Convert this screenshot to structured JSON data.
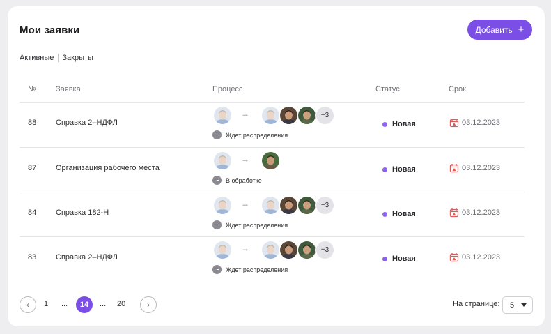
{
  "page": {
    "title": "Мои заявки",
    "add_button": "Добавить",
    "add_icon": "plus-icon"
  },
  "tabs": [
    "Активные",
    "Закрыты"
  ],
  "columns": [
    "№",
    "Заявка",
    "Процесс",
    "Статус",
    "Срок"
  ],
  "rows": [
    {
      "num": "88",
      "request": "Справка 2–НДФЛ",
      "assignees": [
        "a",
        "b",
        "c"
      ],
      "more": "+3",
      "process_status": "Ждет распределения",
      "status": "Новая",
      "deadline": "03.12.2023"
    },
    {
      "num": "87",
      "request": "Организация рабочего места",
      "assignees": [
        "d"
      ],
      "more": "",
      "process_status": "В обработке",
      "status": "Новая",
      "deadline": "03.12.2023"
    },
    {
      "num": "84",
      "request": "Справка 182-Н",
      "assignees": [
        "a",
        "b",
        "c"
      ],
      "more": "+3",
      "process_status": "Ждет распределения",
      "status": "Новая",
      "deadline": "03.12.2023"
    },
    {
      "num": "83",
      "request": "Справка 2–НДФЛ",
      "assignees": [
        "a",
        "b",
        "c"
      ],
      "more": "+3",
      "process_status": "Ждет распределения",
      "status": "Новая",
      "deadline": "03.12.2023"
    }
  ],
  "pagination": {
    "first": "1",
    "ellipsis_left": "...",
    "current": "14",
    "ellipsis_right": "...",
    "last": "20",
    "per_page_label": "На странице:",
    "per_page_value": "5"
  },
  "colors": {
    "accent": "#7b4fe6",
    "status_dot": "#8f63f0",
    "deadline_icon": "#e05a5a"
  }
}
